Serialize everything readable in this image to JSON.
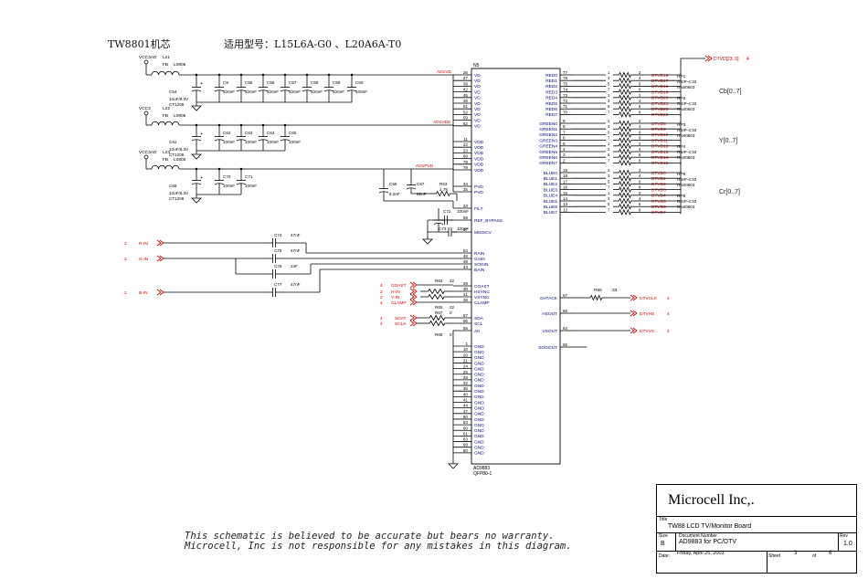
{
  "header": {
    "board": "TW8801机芯",
    "models": "适用型号：L15L6A-G0 、L20A6A-T0"
  },
  "colors": {
    "wire": "#000000",
    "net": "#cc0000",
    "part": "#000080",
    "pin": "#000000"
  },
  "ic": {
    "ref": "N5",
    "part": "AD9883",
    "package": "QFP80-1",
    "vd_pins": [
      "26",
      "27",
      "39",
      "42",
      "45",
      "46",
      "51",
      "52",
      "59",
      "62"
    ],
    "vd_name": "VD",
    "vdd_pins": [
      "11",
      "22",
      "23",
      "69",
      "78",
      "79"
    ],
    "vdd_name": "VDD",
    "pvd_pins": [
      "34",
      "35"
    ],
    "pvd_name": "PVD",
    "filt": [
      "33",
      "FILT"
    ],
    "refbypass": [
      "58",
      "REF_BYPASS"
    ],
    "midscv": [
      "37",
      "MIDSCV"
    ],
    "analog": [
      [
        "54",
        "RAIN"
      ],
      [
        "48",
        "GAIN"
      ],
      [
        "49",
        "SOGIN"
      ],
      [
        "43",
        "BAIN"
      ]
    ],
    "sync": [
      [
        "29",
        "COAST"
      ],
      [
        "30",
        "HSYNC"
      ],
      [
        "31",
        "VSYNC"
      ],
      [
        "38",
        "CLAMP"
      ]
    ],
    "bus": [
      [
        "57",
        "SDA"
      ],
      [
        "56",
        "SCL"
      ],
      [
        "55",
        "A0"
      ]
    ],
    "gnd_pins": [
      "1",
      "10",
      "20",
      "21",
      "24",
      "25",
      "28",
      "32",
      "36",
      "40",
      "41",
      "44",
      "47",
      "50",
      "53",
      "60",
      "61",
      "63",
      "68",
      "80"
    ],
    "gnd_name": "GND",
    "red": [
      [
        "77",
        "RED0"
      ],
      [
        "76",
        "RED1"
      ],
      [
        "75",
        "RED2"
      ],
      [
        "74",
        "RED3"
      ],
      [
        "73",
        "RED4"
      ],
      [
        "72",
        "RED5"
      ],
      [
        "71",
        "RED6"
      ],
      [
        "70",
        "RED7"
      ]
    ],
    "green": [
      [
        "9",
        "GREEN0"
      ],
      [
        "8",
        "GREEN1"
      ],
      [
        "7",
        "GREEN2"
      ],
      [
        "6",
        "GREEN3"
      ],
      [
        "5",
        "GREEN4"
      ],
      [
        "4",
        "GREEN5"
      ],
      [
        "3",
        "GREEN6"
      ],
      [
        "2",
        "GREEN7"
      ]
    ],
    "blue": [
      [
        "19",
        "BLUE0"
      ],
      [
        "18",
        "BLUE1"
      ],
      [
        "17",
        "BLUE2"
      ],
      [
        "16",
        "BLUE3"
      ],
      [
        "15",
        "BLUE4"
      ],
      [
        "14",
        "BLUE5"
      ],
      [
        "13",
        "BLUE6"
      ],
      [
        "12",
        "BLUE7"
      ]
    ],
    "right_misc": [
      [
        "67",
        "DATACK"
      ],
      [
        "66",
        "HSOUT"
      ],
      [
        "64",
        "VSOUT"
      ],
      [
        "65",
        "SOGOUT"
      ]
    ]
  },
  "outputs": {
    "red_nets": [
      "DTVD16",
      "DTVD17",
      "DTVD18",
      "DTVD19",
      "DTVD20",
      "DTVD21",
      "DTVD22",
      "DTVD23"
    ],
    "green_nets": [
      "DTVD8",
      "DTVD9",
      "DTVD10",
      "DTVD11",
      "DTVD12",
      "DTVD13",
      "DTVD14",
      "DTVD15"
    ],
    "blue_nets": [
      "DTVD0",
      "DTVD1",
      "DTVD2",
      "DTVD3",
      "DTVD4",
      "DTVD5",
      "DTVD6",
      "DTVD7"
    ],
    "pin_pairs": [
      [
        "1",
        "2"
      ],
      [
        "3",
        "4"
      ],
      [
        "5",
        "6"
      ],
      [
        "7",
        "8"
      ],
      [
        "1",
        "2"
      ],
      [
        "3",
        "4"
      ],
      [
        "5",
        "6"
      ],
      [
        "7",
        "8"
      ]
    ],
    "bus_label": "DTVD[23..0]",
    "bus_sheet": "4",
    "groups": [
      "Cb[0..7]",
      "Y[0..7]",
      "Cr[0..7]"
    ],
    "rps": [
      {
        "ref": "RP1",
        "val": "RSIP-4:33",
        "pkg": "RN40603"
      },
      {
        "ref": "RP2",
        "val": "RSIP-4:33",
        "pkg": "RN40603"
      },
      {
        "ref": "RP3",
        "val": "RSIP-4:33",
        "pkg": "RN40603"
      },
      {
        "ref": "RP4",
        "val": "RSIP-4:33",
        "pkg": "RN40603"
      },
      {
        "ref": "RP5",
        "val": "RSIP-4:33",
        "pkg": "RN40603"
      },
      {
        "ref": "RP6",
        "val": "RSIP-4:33",
        "pkg": "RN40603"
      }
    ],
    "r66": {
      "ref": "R66",
      "val": "33"
    },
    "dtvclk": "DTVCLK",
    "dtvhs": "DTVHS",
    "dtvvs": "DTVVS",
    "sheet_ref": "4"
  },
  "power": {
    "rails": [
      {
        "vcc": "VCC3AD",
        "l": "L21",
        "fb": "FB",
        "lv": "L0805",
        "net": "AD1VD",
        "cap": [
          "C54",
          "10uF/6.3V",
          "CT1206"
        ],
        "small": [
          [
            "C9",
            "100nF"
          ],
          [
            "C55",
            "100nF"
          ],
          [
            "C56",
            "100nF"
          ],
          [
            "C57",
            "100nF"
          ],
          [
            "C58",
            "100nF"
          ],
          [
            "C59",
            "100nF"
          ],
          [
            "C60",
            "100nF"
          ]
        ]
      },
      {
        "vcc": "VCC3",
        "l": "L22",
        "fb": "FB",
        "lv": "L0805",
        "net": "AD1VDD",
        "cap": [
          "C61",
          "10uF/6.3V",
          "CT1206"
        ],
        "small": [
          [
            "C62",
            "100nF"
          ],
          [
            "C63",
            "100nF"
          ],
          [
            "C64",
            "100nF"
          ],
          [
            "C65",
            "100nF"
          ]
        ]
      },
      {
        "vcc": "VCC3AD",
        "l": "L23",
        "fb": "FB",
        "lv": "L0805",
        "net": "AD1PVD",
        "cap": [
          "C68",
          "10uF/6.3V",
          "CT1206"
        ],
        "small": [
          [
            "C70",
            "100nF"
          ],
          [
            "C71",
            "100nF"
          ]
        ]
      }
    ],
    "filter": {
      "c66": [
        "C66",
        "8.2nF"
      ],
      "c67": [
        "C67",
        "82nF"
      ],
      "r63": [
        "R63",
        "2.7K"
      ]
    },
    "c72": [
      "C72",
      "100nF"
    ],
    "c73": [
      "C73",
      "100nF"
    ]
  },
  "inputs": {
    "analog": [
      {
        "sheet": "2",
        "name": "R-IN",
        "c": "C74",
        "v": "47nF"
      },
      {
        "sheet": "2",
        "name": "G-IN",
        "c": "C75",
        "v": "47nF"
      },
      {
        "sheet": "",
        "name": "",
        "c": "C76",
        "v": "1nF"
      },
      {
        "sheet": "2",
        "name": "B-IN",
        "c": "C77",
        "v": "47nF"
      }
    ],
    "sync": [
      [
        "4",
        "COAST"
      ],
      [
        "2",
        "H-IN"
      ],
      [
        "2",
        "V-IN"
      ],
      [
        "4",
        "CLAMP"
      ]
    ],
    "r64": [
      "R64",
      "22"
    ],
    "r65": [
      "R65",
      "22"
    ],
    "r67": [
      "R67",
      "0"
    ],
    "bus": [
      [
        "4",
        "SDAT"
      ],
      [
        "4",
        "SCLK"
      ]
    ],
    "r68": [
      "R68",
      "0"
    ]
  },
  "disclaimer": {
    "line1": "This schematic is believed to be accurate but bears no warranty.",
    "line2": "Microcell, Inc is not responsible for any mistakes in this diagram."
  },
  "title_block": {
    "company": "Microcell Inc,.",
    "title_label": "Title",
    "title": "TW88 LCD TV/Monitor Board",
    "size_label": "Size",
    "size": "B",
    "doc_label": "Document Number",
    "doc": "AD9883 for PC/DTV",
    "rev_label": "Rev",
    "rev": "1.0",
    "date_label": "Date:",
    "date": "Friday, April 25, 2003",
    "sheet_label": "Sheet",
    "sheet": "3",
    "of_label": "of",
    "sheets": "6"
  }
}
